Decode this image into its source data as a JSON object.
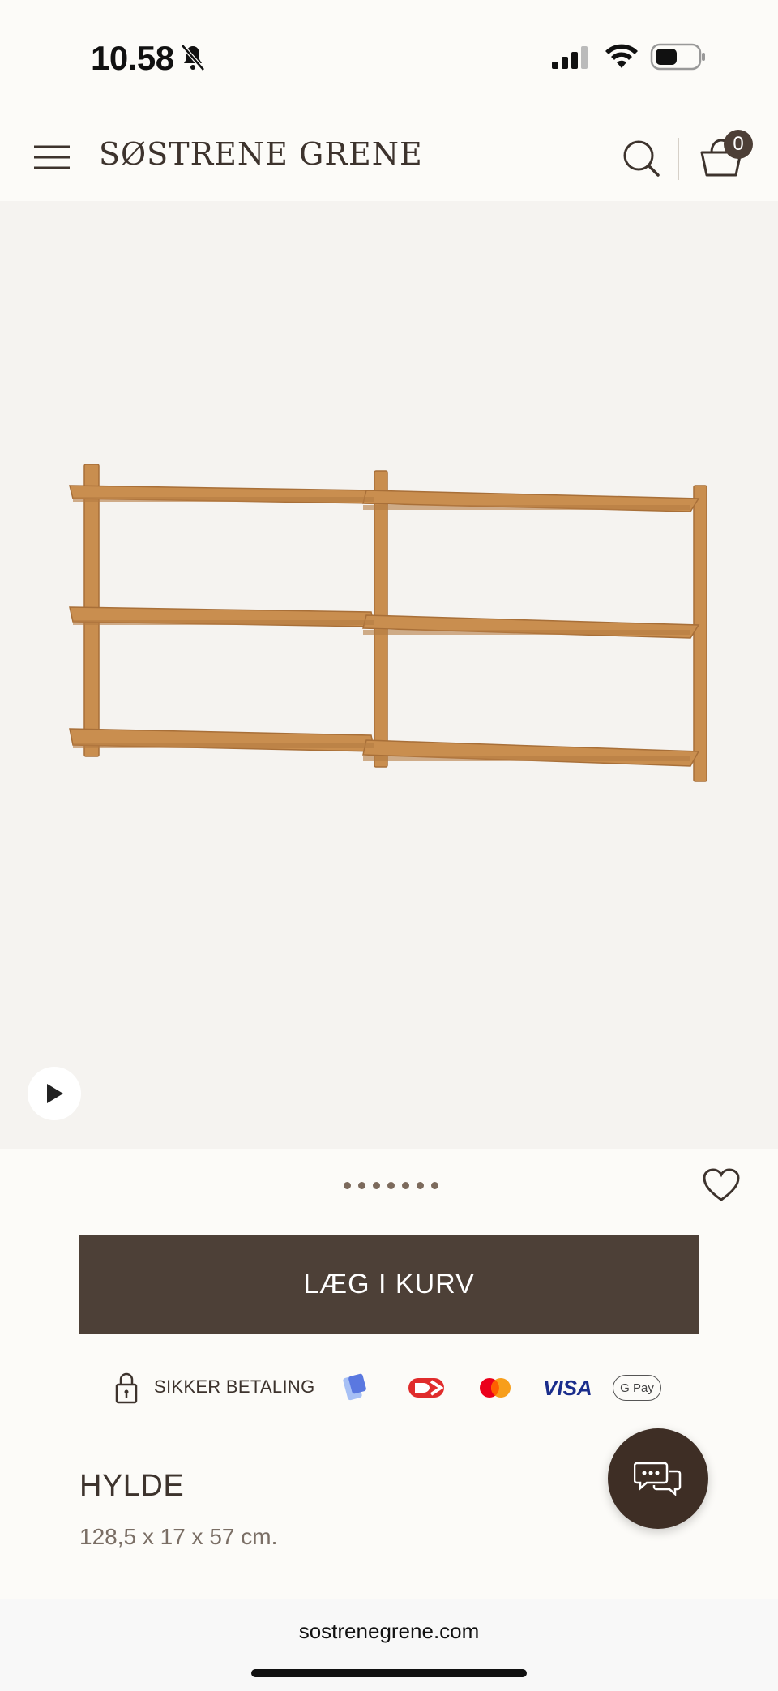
{
  "status_bar": {
    "time": "10.58"
  },
  "header": {
    "logo": "SØSTRENE GRENE",
    "basket_count": "0"
  },
  "product": {
    "image_alt": "Wooden wall shelf",
    "carousel_dot_count": 7,
    "add_to_cart_label": "LÆG I KURV",
    "title": "HYLDE",
    "dimensions": "128,5 x 17 x 57 cm."
  },
  "payment": {
    "secure_label": "SIKKER BETALING",
    "methods": [
      "MobilePay",
      "Dankort",
      "Mastercard",
      "VISA",
      "G Pay"
    ]
  },
  "browser": {
    "url": "sostrenegrene.com"
  },
  "colors": {
    "brand_dark": "#4d4037",
    "chat_bg": "#3e2e25",
    "background": "#fcfbf8",
    "image_bg": "#f5f3f0",
    "wood": "#c98e4f"
  }
}
